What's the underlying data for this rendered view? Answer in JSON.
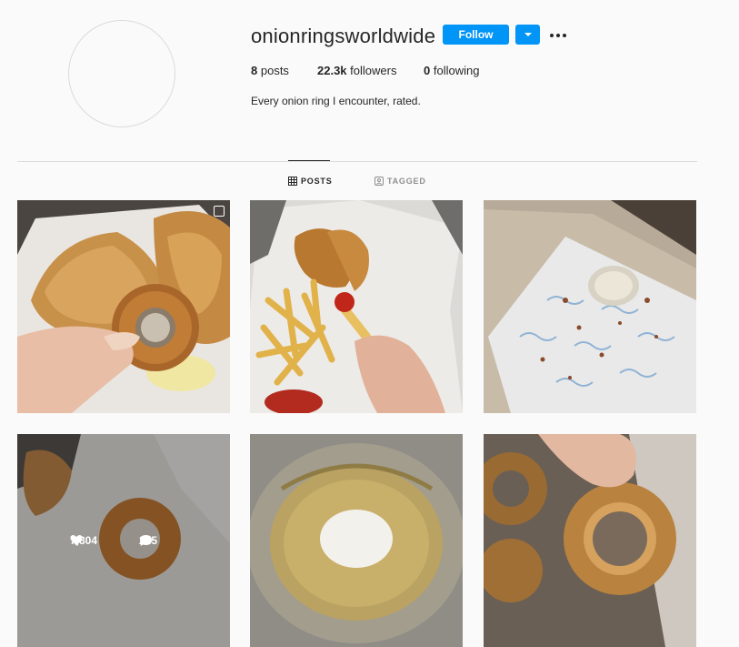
{
  "profile": {
    "username": "onionringsworldwide",
    "follow_label": "Follow",
    "posts_count": "8",
    "posts_label": "posts",
    "followers_count": "22.3k",
    "followers_label": "followers",
    "following_count": "0",
    "following_label": "following",
    "bio": "Every onion ring I encounter, rated."
  },
  "tabs": [
    {
      "label": "POSTS",
      "icon": "grid-icon",
      "active": true
    },
    {
      "label": "TAGGED",
      "icon": "tagged-icon",
      "active": false
    }
  ],
  "posts": [
    {
      "icon": "multi-image-icon"
    },
    {},
    {},
    {
      "likes": "7,804",
      "comments": "265"
    },
    {},
    {}
  ],
  "colors": {
    "accent": "#0095f6",
    "text": "#262626",
    "muted": "#8e8e8e",
    "border": "#dbdbdb"
  }
}
